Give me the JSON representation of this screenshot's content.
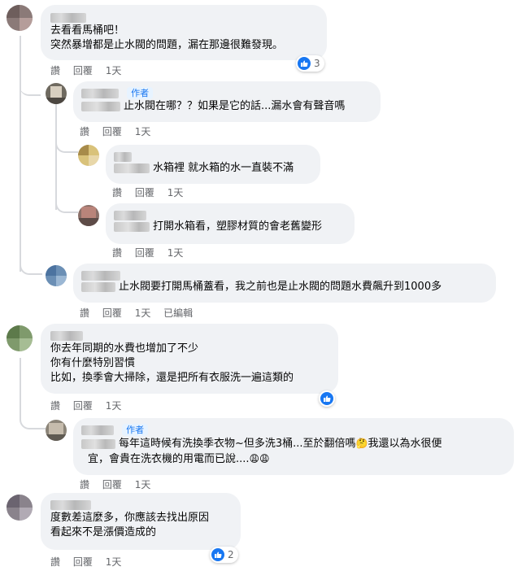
{
  "comments": [
    {
      "lines": [
        "去看看馬桶吧！",
        "突然暴增都是止水閥的問題，漏在那邊很難發現。"
      ],
      "actions": {
        "like": "讚",
        "reply": "回覆",
        "time": "1天"
      },
      "reactions": {
        "icon": "like-icon",
        "count": "3"
      }
    },
    {
      "author_badge": "作者",
      "text": "止水閥在哪？？如果是它的話...漏水會有聲音嗎",
      "actions": {
        "like": "讚",
        "reply": "回覆",
        "time": "1天"
      }
    },
    {
      "text": "水箱裡 就水箱的水一直裝不滿",
      "actions": {
        "like": "讚",
        "reply": "回覆",
        "time": "1天"
      }
    },
    {
      "text": "打開水箱看，塑膠材質的會老舊變形",
      "actions": {
        "like": "讚",
        "reply": "回覆",
        "time": "1天"
      }
    },
    {
      "text": "止水閥要打開馬桶蓋看，我之前也是止水閥的問題水費飆升到1000多",
      "actions": {
        "like": "讚",
        "reply": "回覆",
        "time": "1天",
        "edited": "已編輯"
      }
    },
    {
      "lines": [
        "你去年同期的水費也增加了不少",
        "你有什麼特別習慣",
        "比如，換季會大掃除，還是把所有衣服洗一遍這類的"
      ],
      "actions": {
        "like": "讚",
        "reply": "回覆",
        "time": "1天"
      },
      "reactions": {
        "icon": "like-icon",
        "count": ""
      }
    },
    {
      "author_badge": "作者",
      "line1": "每年這時候有洗換季衣物~但多洗3桶...至於翻倍嗎",
      "line1b": "我還以為水很便",
      "line2": "宜，會貴在洗衣機的用電而已說....",
      "actions": {
        "like": "讚",
        "reply": "回覆",
        "time": "1天"
      }
    },
    {
      "lines": [
        "度數差這麼多，你應該去找出原因",
        "看起來不是漲價造成的"
      ],
      "actions": {
        "like": "讚",
        "reply": "回覆",
        "time": "1天"
      },
      "reactions": {
        "icon": "like-icon",
        "count": "2"
      }
    }
  ],
  "colors": {
    "bubble": "#f0f2f5",
    "accent": "#1877f2",
    "meta": "#65676b"
  }
}
